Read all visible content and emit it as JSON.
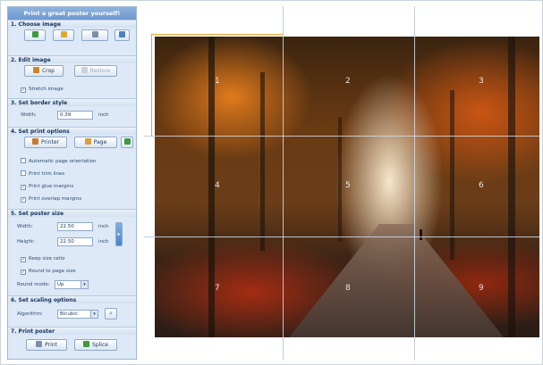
{
  "panel": {
    "title": "Print a great poster yourself!",
    "sections": {
      "choose_image": "1. Choose image",
      "edit_image": "2. Edit image",
      "border_style": "3. Set border style",
      "print_options": "4. Set print options",
      "poster_size": "5. Set poster size",
      "scaling": "6. Set scaling options",
      "print_poster": "7. Print poster"
    },
    "edit": {
      "crop": "Crop",
      "restore": "Restore",
      "stretch": "Stretch image"
    },
    "border": {
      "width_label": "Width:",
      "width_value": "0.39",
      "unit": "inch"
    },
    "print_opts": {
      "printer": "Printer",
      "page": "Page",
      "auto_orientation": "Automatic page orientation",
      "print_trim_lines": "Print trim lines",
      "print_glue_margins": "Print glue margins",
      "print_overlap_margins": "Print overlap margins"
    },
    "size": {
      "width_label": "Width:",
      "width_value": "22.50",
      "height_label": "Height:",
      "height_value": "22.50",
      "unit": "inch",
      "keep_ratio": "Keep size ratio",
      "round_page": "Round to page size",
      "round_mode_label": "Round mode:",
      "round_mode_value": "Up"
    },
    "scaling_opts": {
      "algorithm_label": "Algorithm:",
      "algorithm_value": "Bicubic"
    },
    "print": {
      "print_label": "Print",
      "splice_label": "Splice"
    }
  },
  "preview": {
    "cells": [
      "1",
      "2",
      "3",
      "4",
      "5",
      "6",
      "7",
      "8",
      "9"
    ]
  },
  "colors": {
    "panel_bg": "#dde9f7",
    "accent": "#6d98cf",
    "selection": "#f0a030"
  }
}
